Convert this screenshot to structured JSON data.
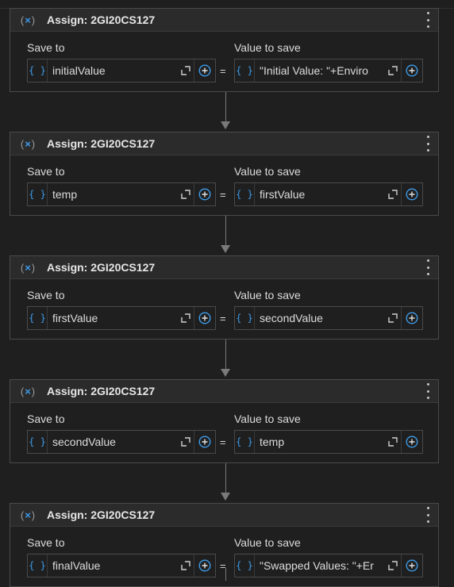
{
  "theme": {
    "accent": "#3d9be9",
    "background": "#1f1f1f",
    "header": "#2b2b2b"
  },
  "activities": [
    {
      "title": "Assign: 2GI20CS127",
      "save_to_label": "Save to",
      "value_label": "Value to save",
      "save_to": "initialValue",
      "value": "\"Initial Value: \"+Enviro"
    },
    {
      "title": "Assign: 2GI20CS127",
      "save_to_label": "Save to",
      "value_label": "Value to save",
      "save_to": "temp",
      "value": "firstValue"
    },
    {
      "title": "Assign: 2GI20CS127",
      "save_to_label": "Save to",
      "value_label": "Value to save",
      "save_to": "firstValue",
      "value": "secondValue"
    },
    {
      "title": "Assign: 2GI20CS127",
      "save_to_label": "Save to",
      "value_label": "Value to save",
      "save_to": "secondValue",
      "value": "temp"
    },
    {
      "title": "Assign: 2GI20CS127",
      "save_to_label": "Save to",
      "value_label": "Value to save",
      "save_to": "finalValue",
      "value": "\"Swapped Values: \"+Er"
    }
  ],
  "icons": {
    "activity": "assign-icon",
    "menu": "more-vertical-icon",
    "variable": "variable-braces-icon",
    "expand": "expand-icon",
    "add": "plus-circle-icon"
  },
  "glyphs": {
    "equals": "=",
    "braces": "{ }",
    "assign_open": "(",
    "assign_x": "×",
    "assign_close": ")"
  }
}
